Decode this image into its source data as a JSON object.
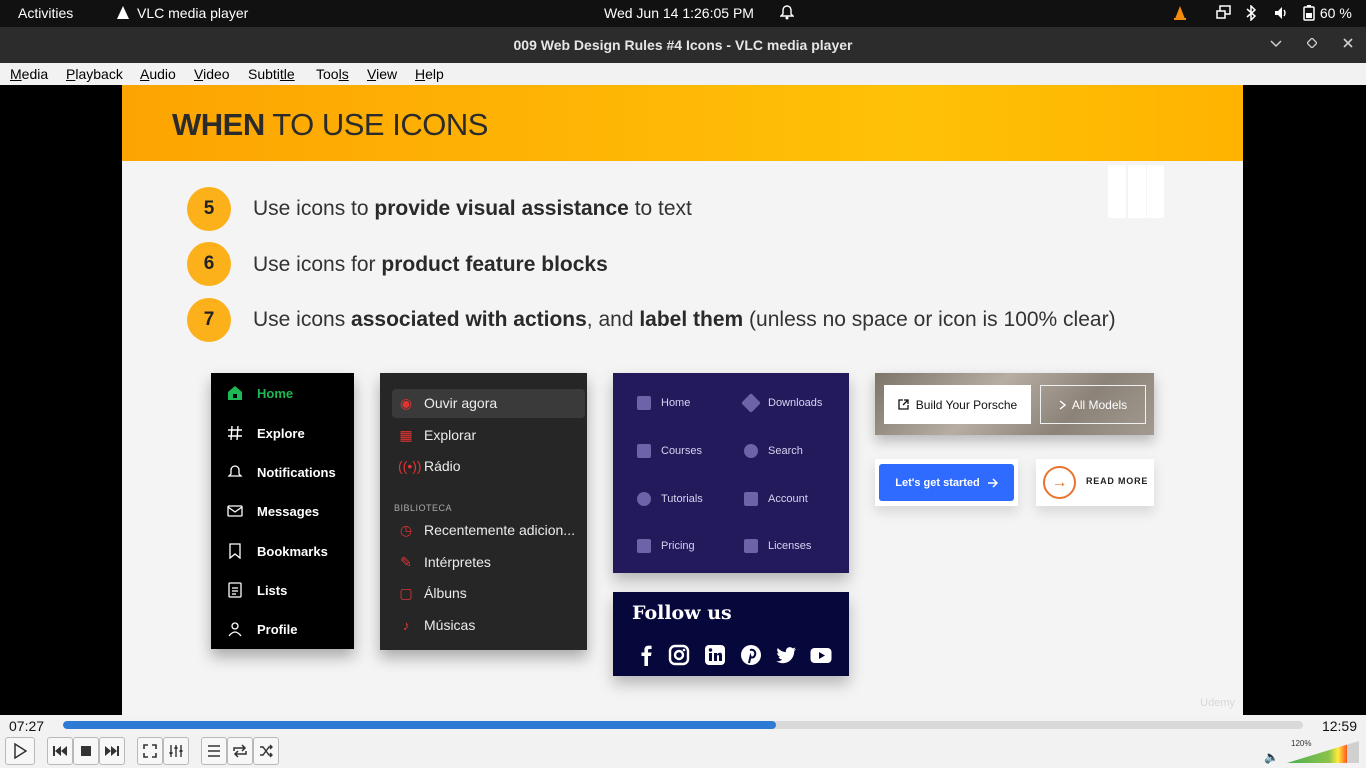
{
  "system_bar": {
    "activities": "Activities",
    "app_name": "VLC media player",
    "clock": "Wed Jun 14   1:26:05 PM",
    "battery": "60 %"
  },
  "window": {
    "title": "009 Web Design Rules #4 Icons - VLC media player"
  },
  "menu": {
    "items": [
      {
        "first": "M",
        "rest": "edia"
      },
      {
        "first": "P",
        "rest": "layback"
      },
      {
        "first": "A",
        "rest": "udio"
      },
      {
        "first": "V",
        "rest": "ideo"
      },
      {
        "first": "Subti",
        "rest": "tle"
      },
      {
        "first": "Too",
        "rest": "ls"
      },
      {
        "first": "V",
        "rest": "iew"
      },
      {
        "first": "H",
        "rest": "elp"
      }
    ]
  },
  "slide": {
    "heading_bold": "WHEN",
    "heading_rest": " TO USE ICONS",
    "rules": [
      {
        "num": "5",
        "pre": "Use icons to ",
        "bold": "provide visual assistance",
        "post": " to text"
      },
      {
        "num": "6",
        "pre": "Use icons for ",
        "bold": "product feature blocks",
        "post": ""
      },
      {
        "num": "7",
        "pre": "Use icons ",
        "bold": "associated with actions",
        "mid": ", and ",
        "bold2": "label them",
        "post": " (unless no space or icon is 100% clear)"
      }
    ],
    "twitter_nav": [
      "Home",
      "Explore",
      "Notifications",
      "Messages",
      "Bookmarks",
      "Lists",
      "Profile"
    ],
    "music_nav": {
      "top": [
        "Ouvir agora",
        "Explorar",
        "Rádio"
      ],
      "section": "BIBLIOTECA",
      "library": [
        "Recentemente adicion...",
        "Intérpretes",
        "Álbuns",
        "Músicas"
      ]
    },
    "feature_grid": [
      "Home",
      "Downloads",
      "Courses",
      "Search",
      "Tutorials",
      "Account",
      "Pricing",
      "Licenses"
    ],
    "follow_title": "Follow us",
    "porsche": {
      "primary": "Build Your Porsche",
      "secondary": "All Models"
    },
    "cta": "Let's get started",
    "read_more": "READ MORE",
    "watermark": "Udemy"
  },
  "player": {
    "current_time": "07:27",
    "total_time": "12:59",
    "progress": 0.575,
    "volume_label": "120%",
    "volume": 1.2
  },
  "colors": {
    "accent": "#fcb11a",
    "twitter_green": "#1db954",
    "music_red": "#e03434",
    "cta_blue": "#2f6bff",
    "seek_blue": "#2e7bd6"
  }
}
